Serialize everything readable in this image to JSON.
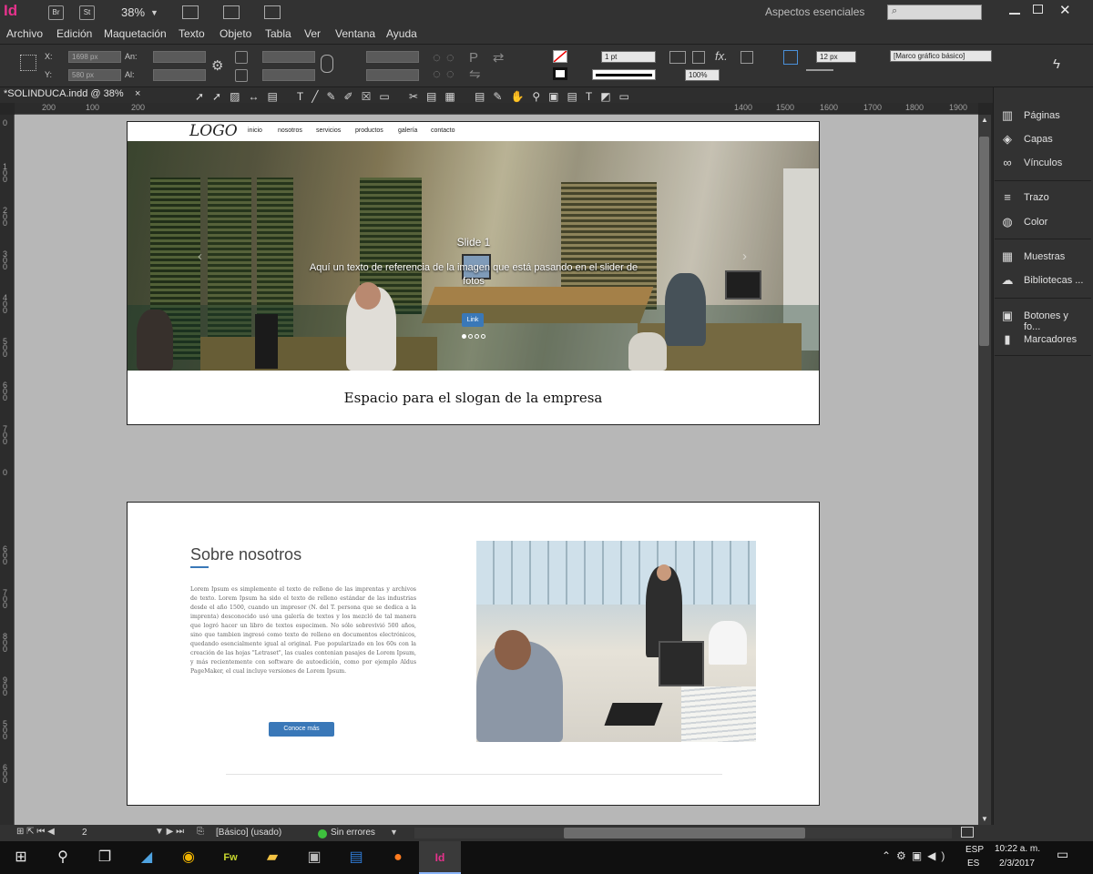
{
  "app": {
    "icon_text": "Id",
    "br_label": "Br",
    "st_label": "St",
    "zoom": "38%",
    "workspace": "Aspectos esenciales"
  },
  "menu": [
    "Archivo",
    "Edición",
    "Maquetación",
    "Texto",
    "Objeto",
    "Tabla",
    "Ver",
    "Ventana",
    "Ayuda"
  ],
  "control": {
    "x_label": "X:",
    "x_value": "1698 px",
    "y_label": "Y:",
    "y_value": "580 px",
    "w_label": "An:",
    "h_label": "Al:",
    "stroke_weight": "1 pt",
    "scale": "100%",
    "corner": "12 px",
    "style": "[Marco gráfico básico]"
  },
  "doc_tab": "*SOLINDUCA.indd @ 38%",
  "ruler": {
    "top": [
      "200",
      "100",
      "200",
      "1400",
      "1500",
      "1600",
      "1700",
      "1800",
      "1900"
    ],
    "left": [
      "0",
      "1 0 0",
      "2 0 0",
      "3 0 0",
      "4 0 0",
      "5 0 0",
      "6 0 0",
      "7 0 0",
      "0",
      "6 0 0",
      "7 0 0",
      "8 0 0",
      "9 0 0",
      "5 0 0",
      "6 0 0"
    ]
  },
  "panels": [
    {
      "label": "Páginas",
      "icon": "pages-icon",
      "glyph": "▥"
    },
    {
      "label": "Capas",
      "icon": "layers-icon",
      "glyph": "◈"
    },
    {
      "label": "Vínculos",
      "icon": "links-icon",
      "glyph": "∞"
    },
    {
      "label": "Trazo",
      "icon": "stroke-icon",
      "glyph": "≡"
    },
    {
      "label": "Color",
      "icon": "color-icon",
      "glyph": "◍"
    },
    {
      "label": "Muestras",
      "icon": "swatches-icon",
      "glyph": "▦"
    },
    {
      "label": "Bibliotecas ...",
      "icon": "libraries-icon",
      "glyph": "☁"
    },
    {
      "label": "Botones y fo...",
      "icon": "buttons-icon",
      "glyph": "▣"
    },
    {
      "label": "Marcadores",
      "icon": "bookmarks-icon",
      "glyph": "▮"
    }
  ],
  "page1": {
    "logo": "LOGO",
    "nav": [
      "inicio",
      "nosotros",
      "servicios",
      "productos",
      "galería",
      "contacto"
    ],
    "slide_title": "Slide 1",
    "slide_text": "Aquí un texto de referencia de la imagen que está pasando en el slider de fotos",
    "slide_button": "Link",
    "slogan": "Espacio para el slogan de la empresa"
  },
  "page2": {
    "heading": "Sobre nosotros",
    "body": "Lorem Ipsum es simplemente el texto de relleno de las imprentas y archivos de texto. Lorem Ipsum ha sido el texto de relleno estándar de las industrias desde el año 1500, cuando un impresor (N. del T. persona que se dedica a la imprenta) desconocido usó una galería de textos y los mezcló de tal manera que logró hacer un libro de textos especimen. No sólo sobrevivió 500 años, sino que tambien ingresó como texto de relleno en documentos electrónicos, quedando esencialmente igual al original. Fue popularizado en los 60s con la creación de las hojas \"Letraset\", las cuales contenian pasajes de Lorem Ipsum, y más recientemente con software de autoedición, como por ejemplo Aldus PageMaker, el cual incluye versiones de Lorem Ipsum.",
    "button": "Conoce más"
  },
  "status": {
    "page": "2",
    "master": "[Básico] (usado)",
    "preflight": "Sin errores",
    "preflight_color": "#3ec13e"
  },
  "taskbar": {
    "lang": "ESP",
    "lang2": "ES",
    "time": "10:22 a. m.",
    "date": "2/3/2017"
  },
  "colors": {
    "accent_blue": "#3a78b8",
    "indesign_pink": "#e6328c"
  }
}
